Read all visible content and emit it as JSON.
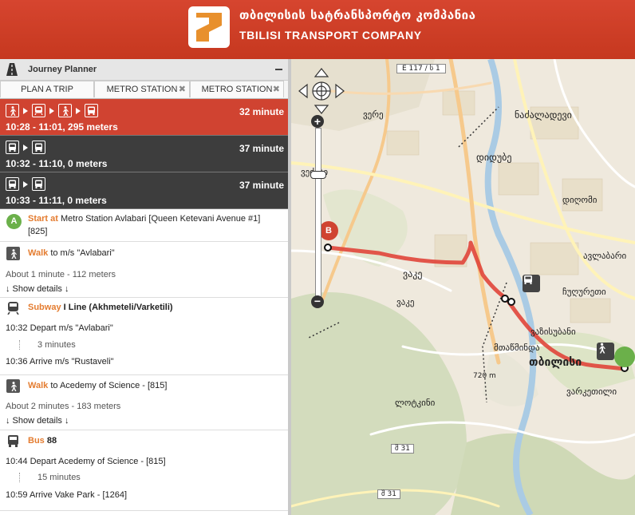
{
  "header": {
    "brand_georgian": "თბილისის სატრანსპორტო კომპანია",
    "brand_english": "TBILISI TRANSPORT COMPANY"
  },
  "panel": {
    "title": "Journey Planner",
    "tabs": [
      {
        "label": "PLAN A TRIP"
      },
      {
        "label": "METRO STATION",
        "close": "✖"
      },
      {
        "label": "METRO STATION",
        "close": "✖"
      }
    ]
  },
  "routes": [
    {
      "icons": [
        "walk-icon",
        "metro-icon",
        "walk-icon",
        "bus-icon"
      ],
      "duration": "32 minute",
      "times": "10:28 - 11:01,  295 meters",
      "selected": true
    },
    {
      "icons": [
        "bus-icon",
        "bus-icon"
      ],
      "duration": "37 minute",
      "times": "10:32 - 11:10,  0 meters",
      "selected": false
    },
    {
      "icons": [
        "bus-icon",
        "bus-icon"
      ],
      "duration": "37 minute",
      "times": "10:33 - 11:11,  0 meters",
      "selected": false
    }
  ],
  "itinerary": {
    "start": {
      "badge": "A",
      "label": "Start at",
      "place_line1": "Metro Station Avlabari [Queen Ketevani Avenue #1]",
      "place_line2": "[825]"
    },
    "walk1": {
      "mode": "Walk",
      "target": "to m/s \"Avlabari\"",
      "meta": "About 1 minute - 112 meters",
      "details": "↓ Show details ↓"
    },
    "subway": {
      "mode": "Subway",
      "line": "I Line (Akhmeteli/Varketili)",
      "depart": "10:32 Depart m/s \"Avlabari\"",
      "duration": "3 minutes",
      "arrive": "10:36 Arrive m/s \"Rustaveli\""
    },
    "walk2": {
      "mode": "Walk",
      "target": "to Acedemy of Science - [815]",
      "meta": "About 2 minutes - 183 meters",
      "details": "↓ Show details ↓"
    },
    "bus": {
      "mode": "Bus",
      "number": "88",
      "depart": "10:44 Depart Acedemy of Science - [815]",
      "duration": "15 minutes",
      "arrive": "10:59 Arrive Vake Park - [1264]"
    }
  },
  "map": {
    "road_badge": "E 117 / ს 1",
    "road_badge2": "შ 31",
    "road_badge3": "შ 31",
    "marker_b": "B",
    "labels": {
      "l1": "ვაკე",
      "l2": "ვერე",
      "l3": "დიდუბე",
      "l4": "ნაძალადევი",
      "l5": "ჩუღურეთი",
      "l6": "ავლაბარი",
      "l7": "თბილისი",
      "l8": "ვაკე",
      "l9": "მთაწმინდა",
      "l10": "ვაზისუბანი",
      "l11": "ვეძისი",
      "l12": "ვარკეთილი",
      "l13": "ლოტკინი",
      "l14": "დიღომი",
      "l15": "720 m"
    },
    "colors": {
      "route": "#e0453a",
      "accent": "#d04331"
    }
  }
}
